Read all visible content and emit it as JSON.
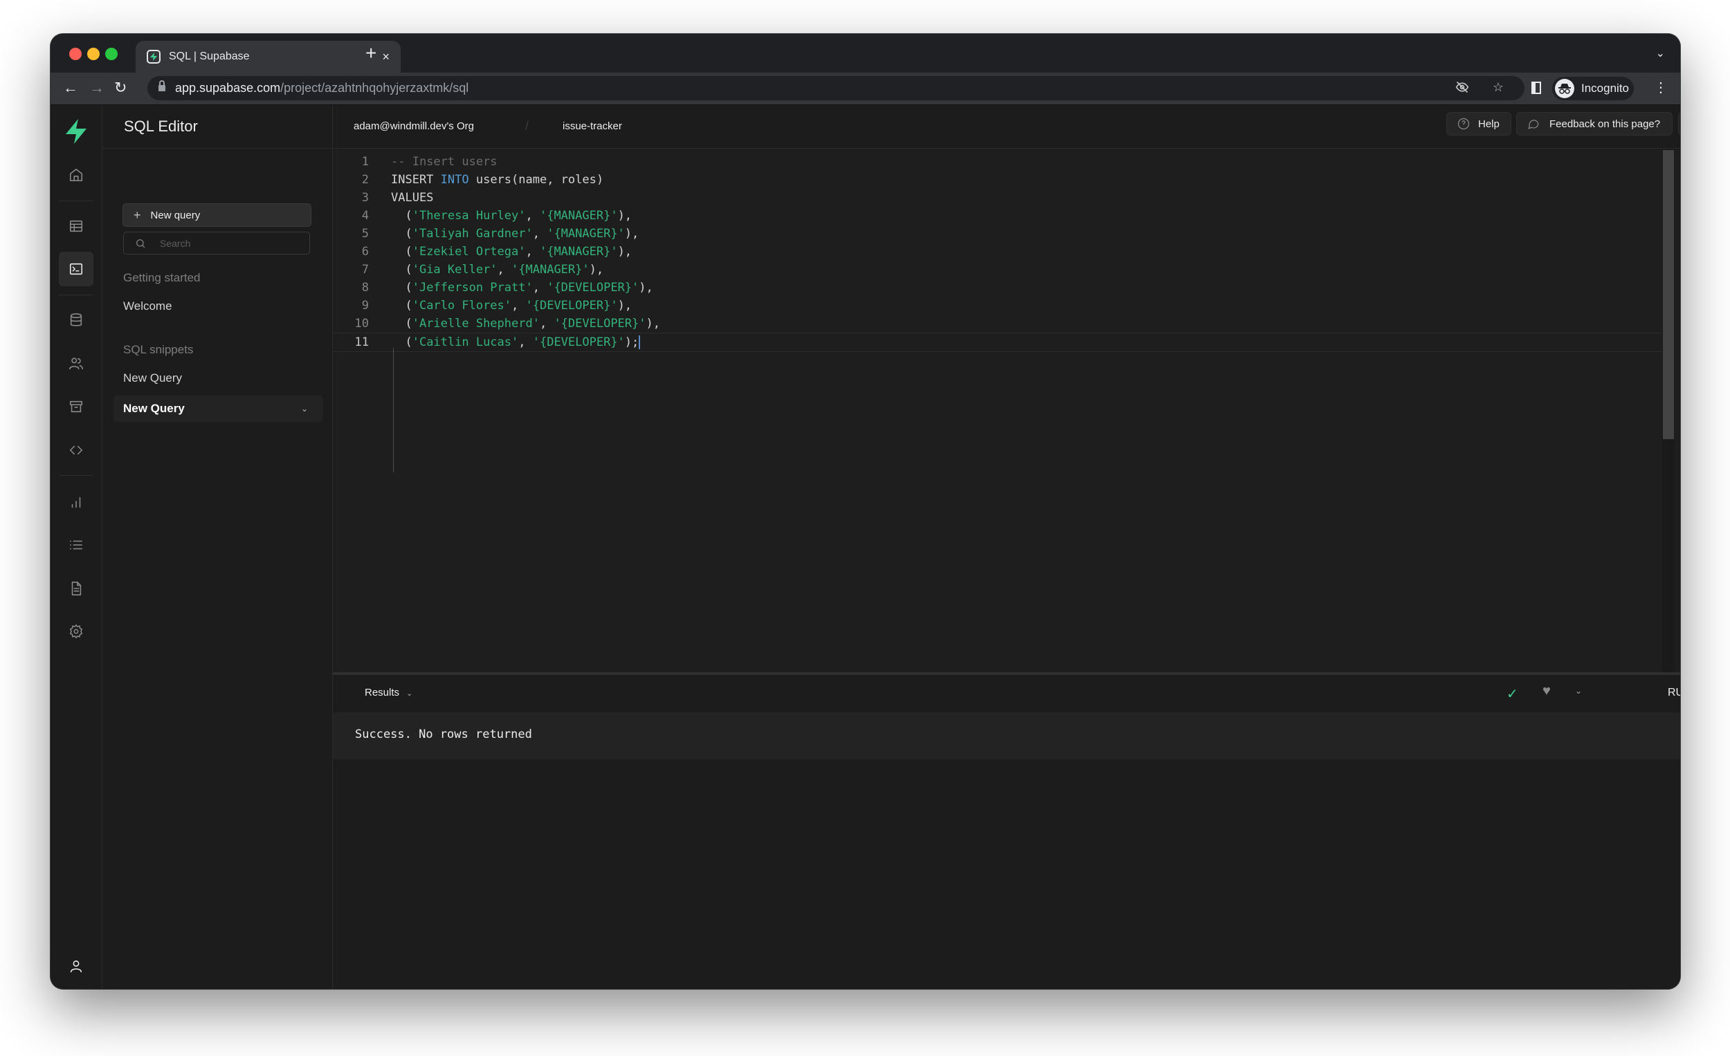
{
  "browser": {
    "tab_title": "SQL | Supabase",
    "tab_close": "×",
    "new_tab": "+",
    "url_host": "app.supabase.com",
    "url_path": "/project/azahtnhqohyjerzaxtmk/sql",
    "profile_label": "Incognito"
  },
  "app": {
    "brand_color": "#3ecf8e",
    "sidebar": {
      "title": "SQL Editor",
      "new_query_label": "New query",
      "search_placeholder": "Search",
      "getting_started_label": "Getting started",
      "getting_started_items": [
        "Welcome"
      ],
      "snippets_label": "SQL snippets",
      "snippets": [
        {
          "label": "New Query",
          "active": false
        },
        {
          "label": "New Query",
          "active": true
        }
      ]
    },
    "rail": {
      "items": [
        "home",
        "table-editor",
        "sql-editor",
        "database",
        "authentication",
        "storage",
        "edge-functions",
        "reports",
        "logs",
        "api-docs",
        "settings"
      ],
      "active": "sql-editor",
      "footer": "account"
    },
    "header": {
      "org": "adam@windmill.dev's Org",
      "separator": "/",
      "project": "issue-tracker",
      "help_label": "Help",
      "feedback_label": "Feedback on this page?"
    },
    "editor": {
      "current_line": 11,
      "lines": [
        {
          "n": "1",
          "tokens": [
            {
              "t": "-- Insert users",
              "k": "comment"
            }
          ]
        },
        {
          "n": "2",
          "tokens": [
            {
              "t": "INSERT ",
              "k": "plain"
            },
            {
              "t": "INTO",
              "k": "kw"
            },
            {
              "t": " users(name, roles)",
              "k": "plain"
            }
          ]
        },
        {
          "n": "3",
          "tokens": [
            {
              "t": "VALUES",
              "k": "plain"
            }
          ]
        },
        {
          "n": "4",
          "tokens": [
            {
              "t": "  (",
              "k": "plain"
            },
            {
              "t": "'Theresa Hurley'",
              "k": "str"
            },
            {
              "t": ", ",
              "k": "plain"
            },
            {
              "t": "'{MANAGER}'",
              "k": "str"
            },
            {
              "t": "),",
              "k": "plain"
            }
          ]
        },
        {
          "n": "5",
          "tokens": [
            {
              "t": "  (",
              "k": "plain"
            },
            {
              "t": "'Taliyah Gardner'",
              "k": "str"
            },
            {
              "t": ", ",
              "k": "plain"
            },
            {
              "t": "'{MANAGER}'",
              "k": "str"
            },
            {
              "t": "),",
              "k": "plain"
            }
          ]
        },
        {
          "n": "6",
          "tokens": [
            {
              "t": "  (",
              "k": "plain"
            },
            {
              "t": "'Ezekiel Ortega'",
              "k": "str"
            },
            {
              "t": ", ",
              "k": "plain"
            },
            {
              "t": "'{MANAGER}'",
              "k": "str"
            },
            {
              "t": "),",
              "k": "plain"
            }
          ]
        },
        {
          "n": "7",
          "tokens": [
            {
              "t": "  (",
              "k": "plain"
            },
            {
              "t": "'Gia Keller'",
              "k": "str"
            },
            {
              "t": ", ",
              "k": "plain"
            },
            {
              "t": "'{MANAGER}'",
              "k": "str"
            },
            {
              "t": "),",
              "k": "plain"
            }
          ]
        },
        {
          "n": "8",
          "tokens": [
            {
              "t": "  (",
              "k": "plain"
            },
            {
              "t": "'Jefferson Pratt'",
              "k": "str"
            },
            {
              "t": ", ",
              "k": "plain"
            },
            {
              "t": "'{DEVELOPER}'",
              "k": "str"
            },
            {
              "t": "),",
              "k": "plain"
            }
          ]
        },
        {
          "n": "9",
          "tokens": [
            {
              "t": "  (",
              "k": "plain"
            },
            {
              "t": "'Carlo Flores'",
              "k": "str"
            },
            {
              "t": ", ",
              "k": "plain"
            },
            {
              "t": "'{DEVELOPER}'",
              "k": "str"
            },
            {
              "t": "),",
              "k": "plain"
            }
          ]
        },
        {
          "n": "10",
          "tokens": [
            {
              "t": "  (",
              "k": "plain"
            },
            {
              "t": "'Arielle Shepherd'",
              "k": "str"
            },
            {
              "t": ", ",
              "k": "plain"
            },
            {
              "t": "'{DEVELOPER}'",
              "k": "str"
            },
            {
              "t": "),",
              "k": "plain"
            }
          ]
        },
        {
          "n": "11",
          "tokens": [
            {
              "t": "  (",
              "k": "plain"
            },
            {
              "t": "'Caitlin Lucas'",
              "k": "str"
            },
            {
              "t": ", ",
              "k": "plain"
            },
            {
              "t": "'{DEVELOPER}'",
              "k": "str"
            },
            {
              "t": ");",
              "k": "plain"
            }
          ]
        }
      ]
    },
    "results": {
      "tab_label": "Results",
      "run_label": "RUN",
      "status": "success",
      "message": "Success. No rows returned"
    }
  }
}
